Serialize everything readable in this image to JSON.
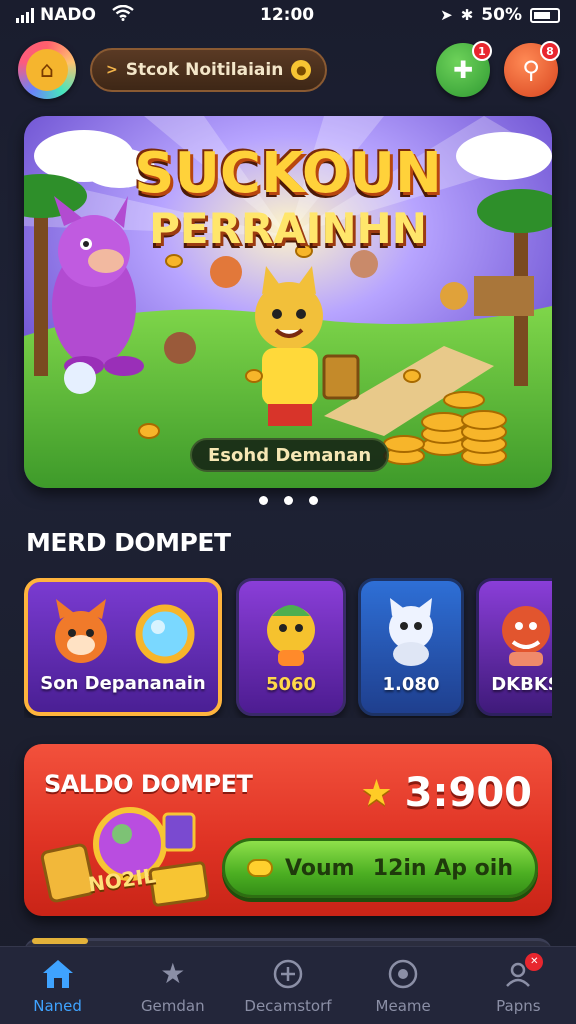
{
  "status_bar": {
    "carrier": "NADO",
    "time": "12:00",
    "battery": "50%"
  },
  "header": {
    "pill_text": "Stcok Noitilaiain",
    "pill_chevron": ">",
    "notification_badge": "1",
    "profile_badge": "8"
  },
  "hero": {
    "title_line1": "SUCKOUN",
    "title_line2": "PERRAINHN",
    "caption": "Esohd Demanan",
    "dots": 3
  },
  "section_title": "MERD DOMPET",
  "cards": [
    {
      "label": "Son Depananain"
    },
    {
      "label": "5060"
    },
    {
      "label": "1.080"
    },
    {
      "label": "DKBKS"
    }
  ],
  "saldo": {
    "title": "SALDO DOMPET",
    "amount": "3:900",
    "button_left": "Voum",
    "button_right": "12in Ap oih",
    "art_text": "NO2IL"
  },
  "bottom_nav": [
    {
      "label": "Naned",
      "icon": "home-icon",
      "active": true
    },
    {
      "label": "Gemdan",
      "icon": "star-icon",
      "active": false
    },
    {
      "label": "Decamstorf",
      "icon": "plus-circle-icon",
      "active": false
    },
    {
      "label": "Meame",
      "icon": "chat-icon",
      "active": false
    },
    {
      "label": "Papns",
      "icon": "profile-icon",
      "active": false
    }
  ],
  "colors": {
    "background": "#1a1d2e",
    "accent_active": "#3fa3ff",
    "saldo_panel": "#e03425",
    "button_green": "#4caf22",
    "card_highlight": "#ffb43d"
  }
}
